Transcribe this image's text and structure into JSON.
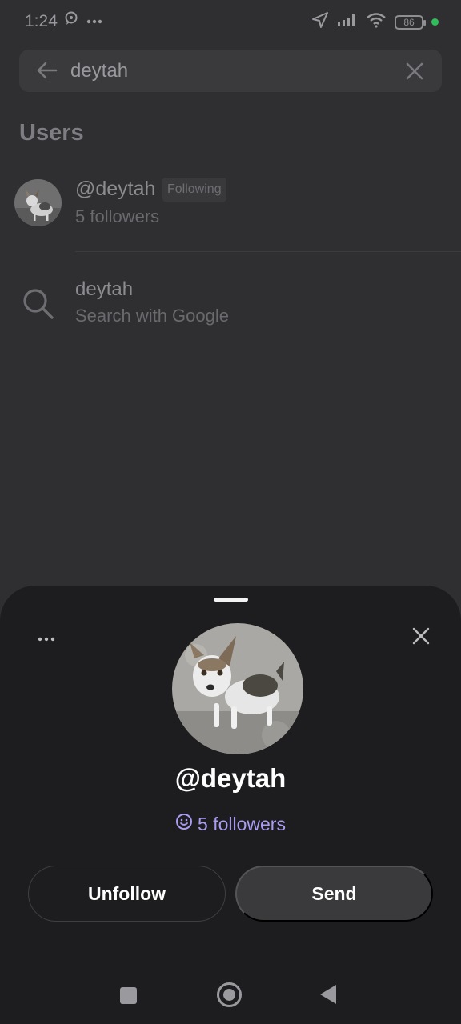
{
  "status_bar": {
    "time": "1:24",
    "battery": "86",
    "icons": [
      "chat-bubble-icon",
      "more-dots-icon",
      "location-arrow-icon",
      "signal-icon",
      "wifi-icon",
      "battery-icon",
      "privacy-dot-icon"
    ]
  },
  "search": {
    "query": "deytah"
  },
  "users_section": {
    "title": "Users",
    "items": [
      {
        "handle": "@deytah",
        "badge": "Following",
        "followers": "5 followers"
      }
    ]
  },
  "google_suggestion": {
    "query": "deytah",
    "subtitle": "Search with Google"
  },
  "profile_sheet": {
    "handle": "@deytah",
    "followers": "5 followers",
    "unfollow_label": "Unfollow",
    "send_label": "Send"
  },
  "colors": {
    "background": "#2f2f32",
    "sheet": "#1d1d1f",
    "accent_followers": "#a99df2",
    "text_primary": "#ffffff"
  }
}
